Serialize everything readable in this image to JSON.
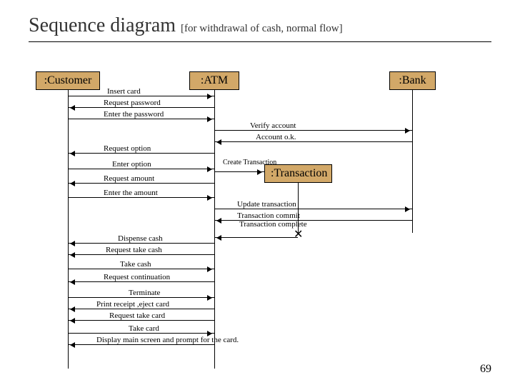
{
  "title": "Sequence diagram",
  "subtitle": "[for withdrawal of cash, normal flow]",
  "page_number": "69",
  "participants": {
    "customer": ":Customer",
    "atm": ":ATM",
    "bank": ":Bank",
    "transaction": ":Transaction"
  },
  "messages": {
    "m1": "Insert card",
    "m2": "Request password",
    "m3": "Enter the password",
    "m4": "Verify account",
    "m5": "Account o.k.",
    "m6": "Request option",
    "m7": "Enter option",
    "m8": "Create Transaction",
    "m9": "Request amount",
    "m10": "Enter the amount",
    "m11": "Update transaction",
    "m12": "Transaction commit",
    "m13": "Transaction complete",
    "m14": "Dispense cash",
    "m15": "Request take cash",
    "m16": "Take cash",
    "m17": "Request continuation",
    "m18": "Terminate",
    "m19": "Print receipt ,eject card",
    "m20": "Request take card",
    "m21": "Take card",
    "m22": "Display main screen and prompt for the card."
  }
}
